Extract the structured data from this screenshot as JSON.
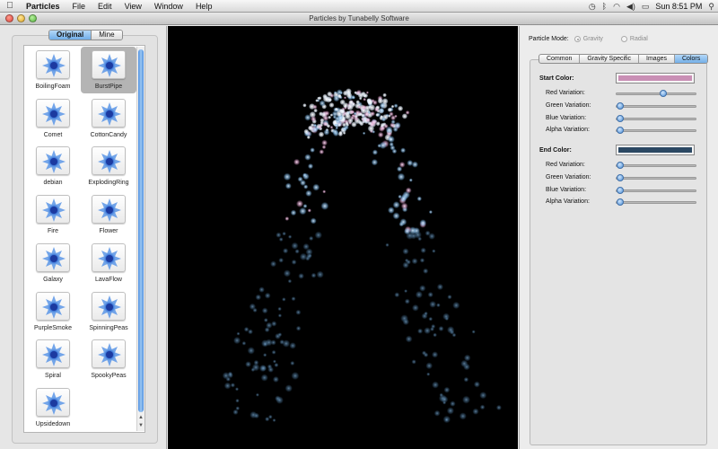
{
  "menubar": {
    "apple_icon": "apple-logo-icon",
    "items": [
      "Particles",
      "File",
      "Edit",
      "View",
      "Window",
      "Help"
    ],
    "status_icons": [
      "time-machine-icon",
      "bluetooth-icon",
      "wifi-icon",
      "volume-icon",
      "battery-icon"
    ],
    "clock": "Sun 8:51 PM",
    "search_icon": "spotlight-search-icon"
  },
  "window": {
    "title": "Particles by Tunabelly Software"
  },
  "library": {
    "segments": [
      "Original",
      "Mine"
    ],
    "active_segment": "Original",
    "presets": [
      "BoilingFoam",
      "BurstPipe",
      "Comet",
      "CottonCandy",
      "debian",
      "ExplodingRing",
      "Fire",
      "Flower",
      "Galaxy",
      "LavaFlow",
      "PurpleSmoke",
      "SpinningPeas",
      "Spiral",
      "SpookyPeas",
      "Upsidedown"
    ],
    "selected": "BurstPipe",
    "scroll_position": 0.02
  },
  "settings": {
    "mode_label": "Particle Mode:",
    "modes": [
      "Gravity",
      "Radial"
    ],
    "selected_mode": "Gravity",
    "tabs": [
      "Common",
      "Gravity Specific",
      "Images",
      "Colors"
    ],
    "active_tab": "Colors",
    "start_color": {
      "label": "Start Color:",
      "color": "#c98fb5",
      "variations": [
        {
          "label": "Red Variation:",
          "value": 0.6
        },
        {
          "label": "Green Variation:",
          "value": 0.0
        },
        {
          "label": "Blue Variation:",
          "value": 0.0
        },
        {
          "label": "Alpha Variation:",
          "value": 0.0
        }
      ]
    },
    "end_color": {
      "label": "End Color:",
      "color": "#2b4863",
      "variations": [
        {
          "label": "Red Variation:",
          "value": 0.0
        },
        {
          "label": "Green Variation:",
          "value": 0.0
        },
        {
          "label": "Blue Variation:",
          "value": 0.0
        },
        {
          "label": "Alpha Variation:",
          "value": 0.0
        }
      ]
    }
  },
  "colors": {
    "accent": "#5a9be6",
    "preview_bg": "#000000"
  }
}
